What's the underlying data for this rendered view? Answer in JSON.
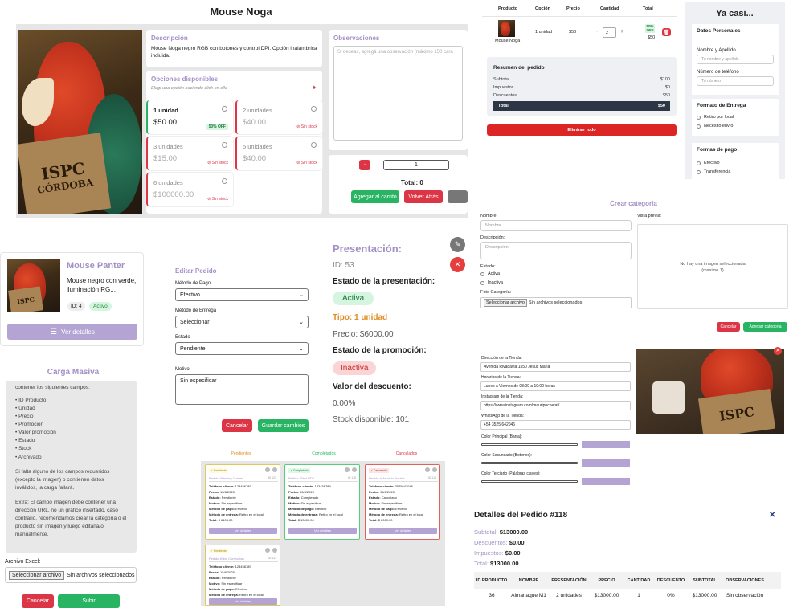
{
  "product": {
    "title": "Mouse Noga",
    "desc_title": "Descripción",
    "desc_text": "Mouse Noga negro RGB con botones y control DPI. Opción inalámbrica incluida.",
    "opts_title": "Opciones disponibles",
    "opts_hint": "Elegí una opción haciendo click en ella",
    "obs_title": "Observaciones",
    "obs_placeholder": "Si deseas, agregá una observación (máximo 150 cara",
    "options": [
      {
        "name": "1 unidad",
        "price": "$50.00",
        "badge": "50% OFF"
      },
      {
        "name": "2 unidades",
        "price": "$40.00",
        "badge": "Sin stock"
      },
      {
        "name": "3 unidades",
        "price": "$15.00",
        "badge": "Sin stock"
      },
      {
        "name": "5 unidades",
        "price": "$40.00",
        "badge": "Sin stock"
      },
      {
        "name": "6 unidades",
        "price": "$100000.00",
        "badge": "Sin stock"
      }
    ],
    "minus": "-",
    "qty": "1",
    "total": "Total: 0",
    "add_cart": "Agregar al carrito",
    "back": "Volver Atrás",
    "book_line1": "ISPC",
    "book_line2": "CÓRDOBA"
  },
  "cart": {
    "headers": [
      "Producto",
      "Opción",
      "Precio",
      "Cantidad",
      "Total"
    ],
    "row": {
      "name": "Mouse Noga",
      "option": "1 unidad",
      "price": "$50",
      "minus": "-",
      "qty": "2",
      "plus": "+",
      "badge": "50% OFF",
      "total": "$50"
    },
    "summary_title": "Resumen del pedido",
    "summary": [
      {
        "k": "Subtotal",
        "v": "$100"
      },
      {
        "k": "Impuestos",
        "v": "$0"
      },
      {
        "k": "Descuentos",
        "v": "$50"
      }
    ],
    "total_k": "Total",
    "total_v": "$50",
    "clear_all": "Eliminar todo"
  },
  "checkout": {
    "title": "Ya casi...",
    "personal": "Datos Personales",
    "name_label": "Nombre y Apellido",
    "name_ph": "Tu nombre y apellido",
    "phone_label": "Número de teléfono",
    "phone_ph": "Tu número",
    "delivery_title": "Formato de Entrega",
    "delivery": [
      "Retiro por local",
      "Necesito envío"
    ],
    "pay_title": "Formas de pago",
    "pay": [
      "Efectivo",
      "Transferencia"
    ]
  },
  "category": {
    "title": "Crear categoría",
    "name_label": "Nombre:",
    "name_ph": "Nombre",
    "desc_label": "Descripción:",
    "desc_ph": "Descripción",
    "state_label": "Estado:",
    "states": [
      "Activa",
      "Inactiva"
    ],
    "photo_label": "Foto Categoría:",
    "file_btn": "Seleccionar archivo",
    "file_none": "Sin archivos seleccionados",
    "preview_label": "Vista previa:",
    "preview_empty": "No hay una imagen seleccionada",
    "preview_max": "(maximo 1)",
    "cancel": "Cancelar",
    "add": "Agregar categoría"
  },
  "mini": {
    "title": "Mouse Panter",
    "desc": "Mouse negro con verde, iluminación RG...",
    "id": "ID: 4",
    "status": "Activo",
    "details": "Ver detalles"
  },
  "edit": {
    "title": "Editar Pedido",
    "pay_label": "Método de Pago",
    "pay_value": "Efectivo",
    "delivery_label": "Método de Entrega",
    "delivery_value": "Seleccionar",
    "state_label": "Estado",
    "state_value": "Pendiente",
    "reason_label": "Motivo",
    "reason_value": "Sin especificar",
    "cancel": "Cancelar",
    "save": "Guardar cambios"
  },
  "presentation": {
    "title": "Presentación:",
    "id": "ID: 53",
    "state_title": "Estado de la presentación:",
    "state": "Activa",
    "type": "Tipo: 1 unidad",
    "price": "Precio: $6000.00",
    "promo_title": "Estado de la promoción:",
    "promo": "Inactiva",
    "discount_title": "Valor del descuento:",
    "discount": "0.00%",
    "stock": "Stock disponible: 101"
  },
  "store": {
    "address_label": "Dirección de la Tienda:",
    "address": "Avenida Rivadavia 1550 Jesús María",
    "hours_label": "Horarios de la Tienda:",
    "hours": "Lunes a Viernes de 08:00 a 19:00 horas",
    "ig_label": "Instagram de la Tienda:",
    "ig": "https://www.instagram.com/mauripuchetaf/",
    "wa_label": "WhatsApp de la Tienda:",
    "wa": "+54 3525 642046",
    "c1": "Color Principal (Barra):",
    "c2": "Color Secundario (Botones):",
    "c3": "Color Terciario (Palabras claves):",
    "swatch": "#b3a4d4"
  },
  "bulk": {
    "title": "Carga Masiva",
    "intro": "contener los siguientes campos:",
    "fields": [
      "• ID Producto",
      "• Unidad",
      "• Precio",
      "• Promoción",
      "• Valor promoción",
      "• Estado",
      "• Stock",
      "• Archivado"
    ],
    "p1": "Si falta alguno de los campos requeridos (excepto la imagen) o contienen datos inválidos, la carga fallará.",
    "p2": "Extra: El campo imagen debe contener una dirección URL, no un gráfico insertado, caso contrario, recomendamos crear la categoría o el producto sin imagen y luego editarla/o manualmente.",
    "excel_label": "Archivo Excel:",
    "file_btn": "Seleccionar archivo",
    "file_none": "Sin archivos seleccionados",
    "cancel": "Cancelar",
    "upload": "Subir"
  },
  "kanban": {
    "cols": [
      "Pendientes",
      "Completados",
      "Cancelados"
    ],
    "cards": [
      {
        "badge": "Pendiente",
        "title": "Pedido #Testing Colores",
        "num": "ID 121",
        "phone": "123456789",
        "date": "15/8/2025",
        "state": "Pendiente",
        "reason": "Sin especificar",
        "pay": "Efectivo",
        "delivery": "Retiro en el local",
        "total": "$ 6105.00"
      },
      {
        "badge": "Completado",
        "title": "Pedido #Test PDF",
        "num": "ID 118",
        "phone": "123456789",
        "date": "15/8/2025",
        "state": "Completado",
        "reason": "Sin especificar",
        "pay": "Efectivo",
        "delivery": "Retiro en el local",
        "total": "$ 13000.00"
      },
      {
        "badge": "Cancelado",
        "title": "Pedido #Mauricio Puchet",
        "num": "ID 116",
        "phone": "3525642046",
        "date": "15/8/2025",
        "state": "Cancelado",
        "reason": "Sin especificar",
        "pay": "Efectivo",
        "delivery": "Retiro en el local",
        "total": "$ 6000.00"
      },
      {
        "badge": "Pendiente",
        "title": "Pedido #Test Correccion",
        "num": "ID 113",
        "phone": "123456789",
        "date": "15/8/2025",
        "state": "Pendiente",
        "reason": "Sin especificar",
        "pay": "Efectivo",
        "delivery": "Retiro en el local",
        "total": "$ 5100.00"
      }
    ],
    "labels": {
      "phone": "Teléfono cliente:",
      "date": "Fecha:",
      "state": "Estado:",
      "reason": "Motivo:",
      "pay": "Método de pago:",
      "delivery": "Método de entrega:",
      "total": "Total:"
    },
    "details": "Ver detalles"
  },
  "order": {
    "title": "Detalles del Pedido #118",
    "close": "✕",
    "subtotal_k": "Subtotal:",
    "subtotal_v": "$13000.00",
    "desc_k": "Descuentos:",
    "desc_v": "$0.00",
    "tax_k": "Impuestos:",
    "tax_v": "$0.00",
    "total_k": "Total:",
    "total_v": "$13000.00",
    "headers": [
      "ID PRODUCTO",
      "NOMBRE",
      "PRESENTACIÓN",
      "PRECIO",
      "CANTIDAD",
      "DESCUENTO",
      "SUBTOTAL",
      "OBSERVACIONES"
    ],
    "row": [
      "36",
      "Almanaque M1",
      "2 unidades",
      "$13000.00",
      "1",
      "0%",
      "$13000.00",
      "Sin observación"
    ]
  }
}
